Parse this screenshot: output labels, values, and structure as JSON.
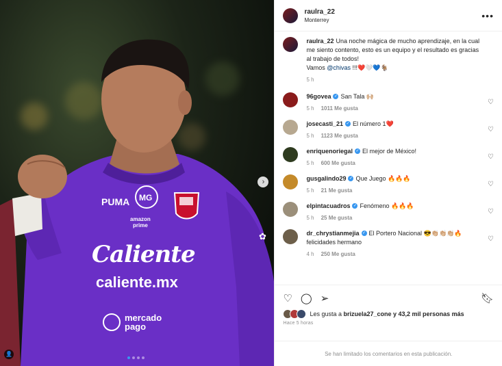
{
  "post": {
    "username": "raulra_22",
    "location": "Monterrey",
    "more_icon": "more-horizontal-icon",
    "caption": {
      "username": "raulra_22",
      "text": "Una noche mágica de mucho aprendizaje, en la cual me siento contento, esto es un equipo y el resultado es gracias al trabajo de todos!",
      "line2_prefix": "Vamos ",
      "mention": "@chivas",
      "line2_suffix": " !!!❤️🤍💙🐐",
      "time": "5 h"
    },
    "image": {
      "jersey_brand": "Caliente",
      "jersey_site": "caliente.mx",
      "sponsor_top": "amazon",
      "sponsor_top2": "prime",
      "sponsor_bottom": "mercado",
      "sponsor_bottom2": "pago",
      "carousel_total": 4,
      "carousel_active": 1
    }
  },
  "comments": [
    {
      "user": "96govea",
      "verified": true,
      "text": "San Tala 🙌🏼",
      "time": "5 h",
      "likes": "1011 Me gusta",
      "avatar_color": "#8a1b1b"
    },
    {
      "user": "josecasti_21",
      "verified": true,
      "text": "El número 1❤️",
      "time": "5 h",
      "likes": "1123 Me gusta",
      "avatar_color": "#b7a890"
    },
    {
      "user": "enriquenoriegal",
      "verified": true,
      "text": "El mejor de México!",
      "time": "5 h",
      "likes": "600 Me gusta",
      "avatar_color": "#2e3b1f"
    },
    {
      "user": "gusgalindo29",
      "verified": true,
      "text": "Que Juego 🔥🔥🔥",
      "time": "5 h",
      "likes": "21 Me gusta",
      "avatar_color": "#c48a2a"
    },
    {
      "user": "elpintacuadros",
      "verified": true,
      "text": "Fenómeno 🔥🔥🔥",
      "time": "5 h",
      "likes": "25 Me gusta",
      "avatar_color": "#9b8f7a"
    },
    {
      "user": "dr_chrystianmejia",
      "verified": true,
      "text": "El Portero Nacional 😎👏🏼👏🏼👏🏼🔥 felicidades hermano",
      "time": "4 h",
      "likes": "250 Me gusta",
      "avatar_color": "#6d5f4a"
    }
  ],
  "actions": {
    "like_icon": "heart-icon",
    "comment_icon": "comment-icon",
    "share_icon": "send-icon",
    "save_icon": "bookmark-icon",
    "liked_by_prefix": "Les gusta a ",
    "liked_by_user": "brizuela27_cone",
    "liked_by_suffix": " y 43,2 mil personas más",
    "posted_ago": "Hace 5 horas",
    "comments_limited": "Se han limitado los comentarios en esta publicación."
  },
  "colors": {
    "jersey": "#6a2fc6",
    "verified": "#3897f0",
    "mention": "#00376b",
    "muted": "#8e8e8e"
  }
}
